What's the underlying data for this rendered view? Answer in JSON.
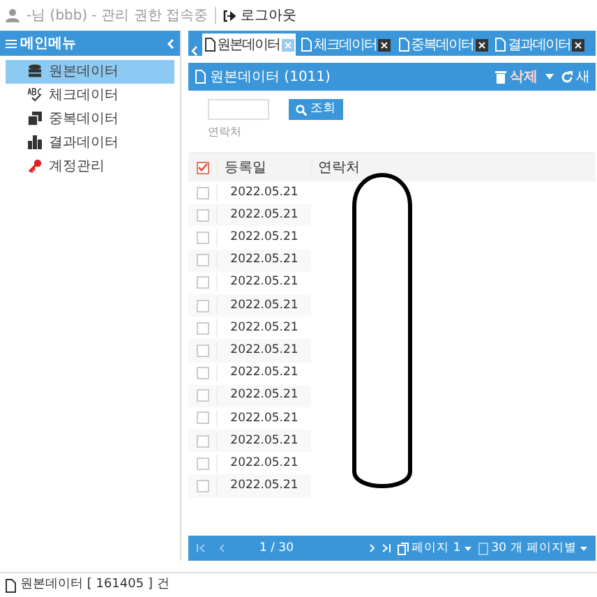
{
  "top_bar": {
    "user_text": "-님 (bbb) - 관리 권한 접속중",
    "logout": "로그아웃"
  },
  "sidebar": {
    "title": "메인메뉴",
    "items": [
      {
        "label": "원본데이터",
        "kind": "database",
        "selected": true
      },
      {
        "label": "체크데이터",
        "kind": "spellcheck",
        "selected": false
      },
      {
        "label": "중복데이터",
        "kind": "copies",
        "selected": false
      },
      {
        "label": "결과데이터",
        "kind": "chart",
        "selected": false
      },
      {
        "label": "계정관리",
        "kind": "key",
        "selected": false
      }
    ]
  },
  "tabs": [
    {
      "label": "원본데이터",
      "selected": true
    },
    {
      "label": "체크데이터",
      "selected": false
    },
    {
      "label": "중복데이터",
      "selected": false
    },
    {
      "label": "결과데이터",
      "selected": false
    }
  ],
  "panel": {
    "title": "원본데이터 (1011)",
    "delete": "삭제",
    "refresh": "새"
  },
  "search": {
    "field_label": "연락처",
    "button": "조회"
  },
  "table": {
    "header_checked": true,
    "columns": [
      "등록일",
      "연락처"
    ],
    "rows": [
      {
        "date": "2022.05.21",
        "checked": false
      },
      {
        "date": "2022.05.21",
        "checked": false
      },
      {
        "date": "2022.05.21",
        "checked": false
      },
      {
        "date": "2022.05.21",
        "checked": false
      },
      {
        "date": "2022.05.21",
        "checked": false
      },
      {
        "date": "2022.05.21",
        "checked": false
      },
      {
        "date": "2022.05.21",
        "checked": false
      },
      {
        "date": "2022.05.21",
        "checked": false
      },
      {
        "date": "2022.05.21",
        "checked": false
      },
      {
        "date": "2022.05.21",
        "checked": false
      },
      {
        "date": "2022.05.21",
        "checked": false
      },
      {
        "date": "2022.05.21",
        "checked": false
      },
      {
        "date": "2022.05.21",
        "checked": false
      },
      {
        "date": "2022.05.21",
        "checked": false
      }
    ]
  },
  "pager": {
    "position": "1 / 30",
    "page": "페이지 1",
    "per_page": "30 개 페이지별"
  },
  "status_bar": "원본데이터 [ 161405 ] 건"
}
